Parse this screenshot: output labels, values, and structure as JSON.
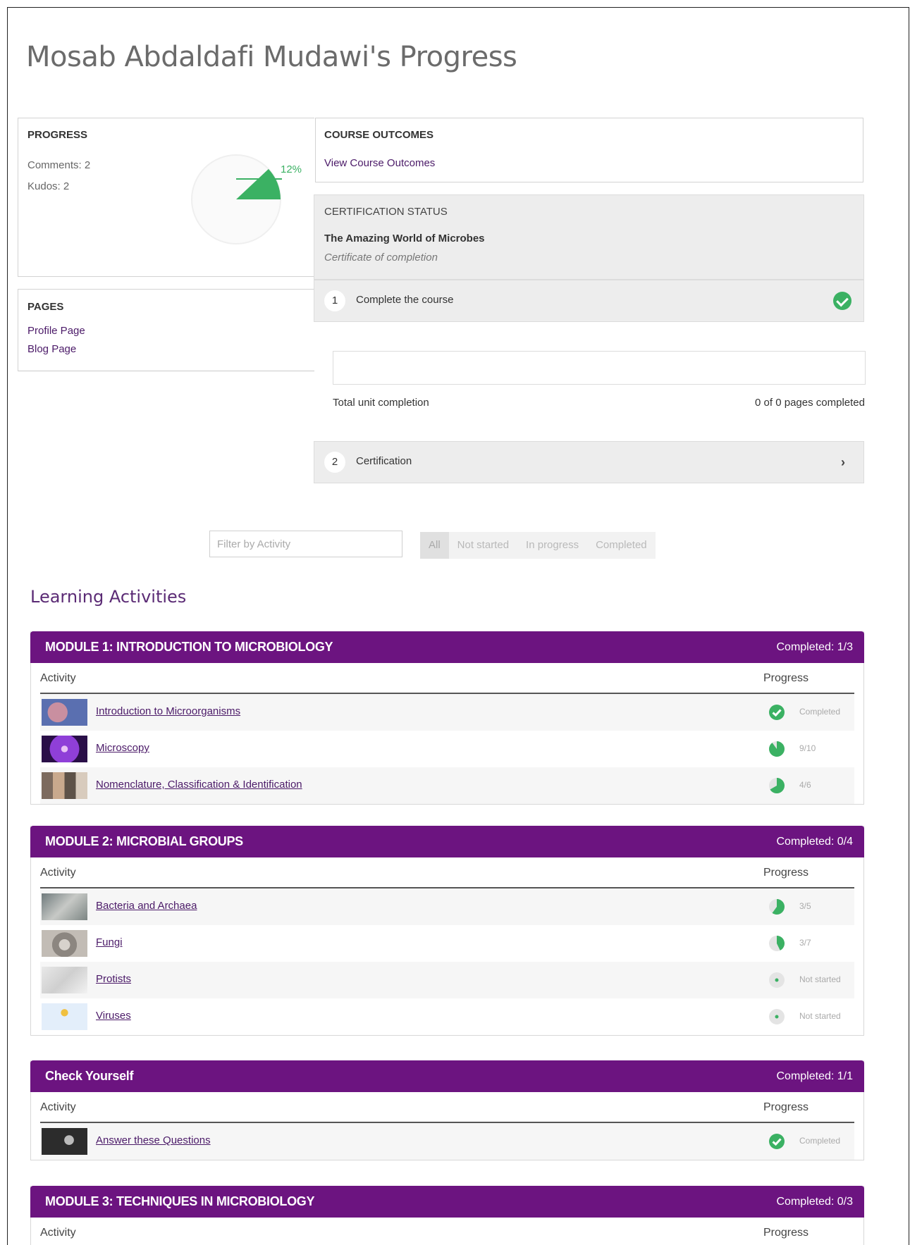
{
  "page": {
    "title": "Mosab Abdaldafi Mudawi's Progress"
  },
  "progress": {
    "heading": "PROGRESS",
    "comments": "Comments: 2",
    "kudos": "Kudos: 2",
    "percent_label": "12%",
    "percent": 0.12,
    "accent": "#3bb163"
  },
  "pages": {
    "heading": "PAGES",
    "links": [
      "Profile Page",
      "Blog Page"
    ]
  },
  "outcomes": {
    "heading": "COURSE OUTCOMES",
    "link": "View Course Outcomes"
  },
  "certification": {
    "heading": "CERTIFICATION STATUS",
    "name": "The Amazing World of Microbes",
    "subtitle": "Certificate of completion",
    "steps": [
      {
        "num": "1",
        "label": "Complete the course",
        "status": "check-icon"
      },
      {
        "num": "2",
        "label": "Certification",
        "status": "chevron-right-icon"
      }
    ],
    "unit_label": "Total unit completion",
    "unit_count": "0 of 0 pages completed",
    "unit_fraction": 0
  },
  "filter": {
    "placeholder": "Filter by Activity",
    "options": [
      "All",
      "Not started",
      "In progress",
      "Completed"
    ],
    "selected": "All"
  },
  "section_heading": "Learning Activities",
  "table_headers": {
    "activity": "Activity",
    "progress": "Progress"
  },
  "modules": [
    {
      "title": "MODULE 1: INTRODUCTION TO MICROBIOLOGY",
      "completed": "Completed: 1/3",
      "rows": [
        {
          "name": "Introduction to Microorganisms",
          "status": "Completed",
          "fraction": 1,
          "thumb": "microorganism-thumbnail"
        },
        {
          "name": "Microscopy",
          "status": "9/10",
          "fraction": 0.9,
          "thumb": "microscopy-thumbnail"
        },
        {
          "name": "Nomenclature, Classification & Identification",
          "status": "4/6",
          "fraction": 0.667,
          "thumb": "classification-thumbnail"
        }
      ]
    },
    {
      "title": "MODULE 2: MICROBIAL GROUPS",
      "completed": "Completed: 0/4",
      "rows": [
        {
          "name": "Bacteria and Archaea",
          "status": "3/5",
          "fraction": 0.6,
          "thumb": "bacteria-thumbnail"
        },
        {
          "name": "Fungi",
          "status": "3/7",
          "fraction": 0.429,
          "thumb": "fungi-thumbnail"
        },
        {
          "name": "Protists",
          "status": "Not started",
          "fraction": 0,
          "thumb": "protists-thumbnail"
        },
        {
          "name": "Viruses",
          "status": "Not started",
          "fraction": 0,
          "thumb": "viruses-thumbnail"
        }
      ]
    },
    {
      "title": "Check Yourself",
      "completed": "Completed: 1/1",
      "rows": [
        {
          "name": "Answer these Questions",
          "status": "Completed",
          "fraction": 1,
          "thumb": "questions-thumbnail"
        }
      ]
    },
    {
      "title": "MODULE 3: TECHNIQUES IN MICROBIOLOGY",
      "completed": "Completed: 0/3",
      "rows": []
    }
  ],
  "colors": {
    "module_header": "#6c1480",
    "link": "#4b1a68",
    "success": "#3bb163",
    "panel": "#ededed"
  }
}
